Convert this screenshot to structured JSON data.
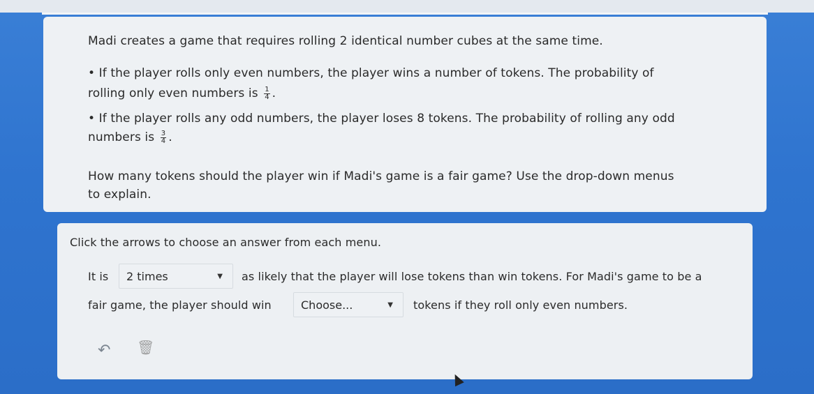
{
  "problem": {
    "intro": "Madi creates a game that requires rolling 2 identical number cubes at the same time.",
    "bullets": [
      {
        "line1": "• If the player rolls only even numbers, the player wins a number of tokens. The probability of",
        "line2_prefix": "rolling only even numbers is",
        "frac_num": "1",
        "frac_den": "4",
        "line2_suffix": "."
      },
      {
        "line1": "• If the player rolls any odd numbers, the player loses 8 tokens. The probability of rolling any odd",
        "line2_prefix": "numbers is",
        "frac_num": "3",
        "frac_den": "4",
        "line2_suffix": "."
      }
    ],
    "question_line1": "How many tokens should the player win if Madi's game is a fair game? Use the drop-down menus",
    "question_line2": "to explain."
  },
  "answer": {
    "instruction": "Click the arrows to choose an answer from each menu.",
    "row1_prefix": "It is",
    "dropdown1_value": "2 times",
    "row1_suffix": "as likely that the player will lose tokens than win tokens. For Madi's game to be a",
    "row2_prefix": "fair game, the player should win",
    "dropdown2_value": "Choose...",
    "row2_suffix": "tokens if they roll only even numbers.",
    "dropdown_arrow": "▼"
  },
  "toolbar": {
    "undo_icon": "↶",
    "trash_icon": "🗑"
  }
}
